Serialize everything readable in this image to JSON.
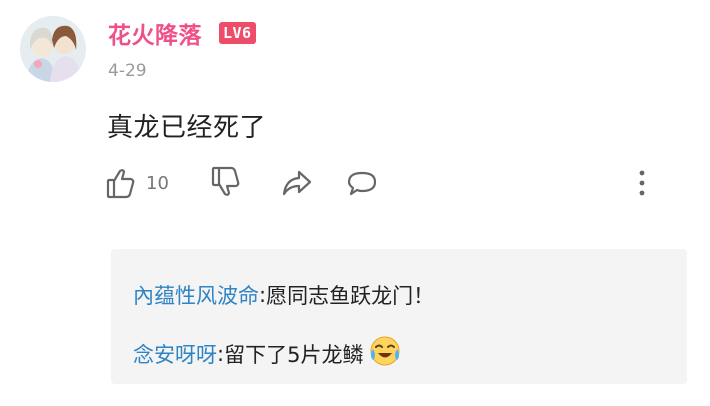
{
  "comment": {
    "username": "花火降落",
    "level_badge": "LV6",
    "date": "4-29",
    "text": "真龙已经死了",
    "like_count": "10"
  },
  "icons": {
    "like": "thumbs-up-icon",
    "dislike": "thumbs-down-icon",
    "share": "share-arrow-icon",
    "reply": "speech-bubble-icon",
    "more": "more-vertical-icon",
    "emoji": "crying-laughing-emoji"
  },
  "replies": [
    {
      "author": "內蕴性风波命",
      "separator": ": ",
      "text": "愿同志鱼跃龙门！"
    },
    {
      "author": "念安呀呀",
      "separator": ": ",
      "text": "留下了5片龙鳞"
    }
  ],
  "colors": {
    "username": "#f0508a",
    "level_badge": "#ee4d6a",
    "reply_author": "#2f84c4",
    "reply_box_bg": "#f4f4f4"
  }
}
